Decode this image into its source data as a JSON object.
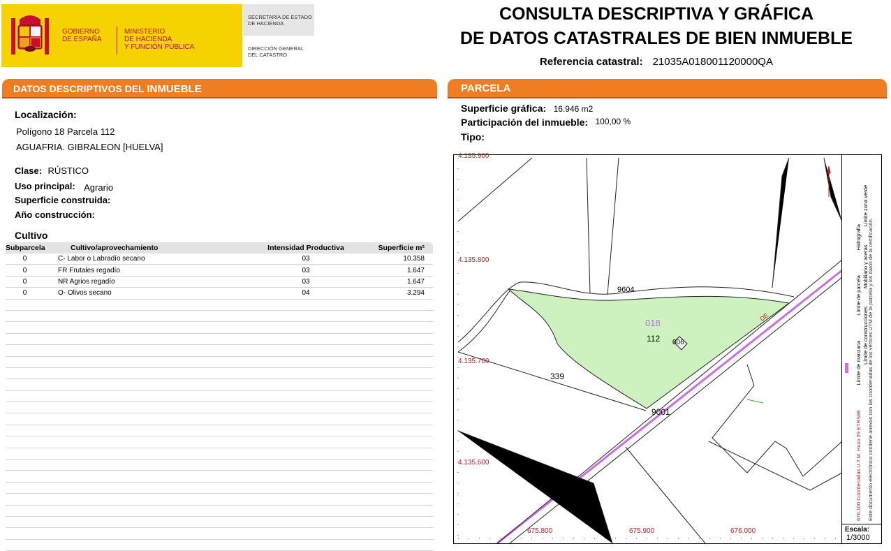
{
  "header": {
    "gobierno": [
      "GOBIERNO",
      "DE ESPAÑA"
    ],
    "ministerio": [
      "MINISTERIO",
      "DE HACIENDA",
      "Y FUNCIÓN PÚBLICA"
    ],
    "secretaria": [
      "SECRETARÍA DE ESTADO",
      "DE HACIENDA"
    ],
    "direccion": [
      "DIRECCIÓN GENERAL",
      "DEL CATASTRO"
    ],
    "title_line1": "CONSULTA DESCRIPTIVA Y GRÁFICA",
    "title_line2": "DE DATOS CATASTRALES DE BIEN INMUEBLE",
    "ref_label": "Referencia catastral:",
    "ref_value": "21035A018001120000QA"
  },
  "left": {
    "section_title_a": "DATOS DESCRIPTIVOS DEL ",
    "section_title_b": "INMUEBLE",
    "localizacion_label": "Localización:",
    "localizacion_line1": "Polígono 18 Parcela 112",
    "localizacion_line2": "AGUAFRIA. GIBRALEON [HUELVA]",
    "clase_label": "Clase:",
    "clase_value": "RÚSTICO",
    "uso_label": "Uso principal:",
    "uso_value": "Agrario",
    "sup_construida_label": "Superficie construida:",
    "anio_label": "Año construcción:",
    "cultivo_title": "Cultivo",
    "table": {
      "headers": [
        "Subparcela",
        "Cultivo/aprovechamiento",
        "Intensidad Productiva",
        "Superficie m²"
      ],
      "rows": [
        [
          "0",
          "C- Labor o Labradío secano",
          "03",
          "10.358"
        ],
        [
          "0",
          "FR Frutales regadío",
          "03",
          "1.647"
        ],
        [
          "0",
          "NR Agrios regadío",
          "03",
          "1.647"
        ],
        [
          "0",
          "O- Olivos secano",
          "04",
          "3.294"
        ]
      ]
    }
  },
  "right": {
    "section_title": "PARCELA",
    "sup_grafica_label": "Superficie gráfica:",
    "sup_grafica_value": "16.946 m2",
    "participacion_label": "Participación del inmueble:",
    "participacion_value": "100,00 %",
    "tipo_label": "Tipo:"
  },
  "map": {
    "y_coords": [
      "4.135.900",
      "4.135.800",
      "4.135.700",
      "4.135.600"
    ],
    "x_coords": [
      "675.800",
      "675.900",
      "676.000"
    ],
    "labels": {
      "road_top": "9604",
      "poligono": "018",
      "parcela": "112",
      "building": "006",
      "neighbor": "339",
      "road_bottom": "9001",
      "de": "DE"
    },
    "legend": {
      "col1": "Este documento electrónico contiene anexos con las coordenadas de los vértices UTM de la parcela y los datos de la certificación.",
      "col2a": "676.100 Coordenadas U.T.M. Huso 29 ETRS89",
      "col2b": "Límite de manzana",
      "col2c": "Límite de parcela",
      "col2d": "Hidrografía",
      "col3a": "Límite de construcciones",
      "col3b": "Mobiliario y aceras",
      "col3c": "Límite zona verde"
    },
    "scale_label": "Escala:",
    "scale_value": "1/3000",
    "colors": {
      "parcel_fill": "#cdf2c0",
      "road_line": "#c86ee0",
      "coord_text": "#b22222"
    }
  }
}
